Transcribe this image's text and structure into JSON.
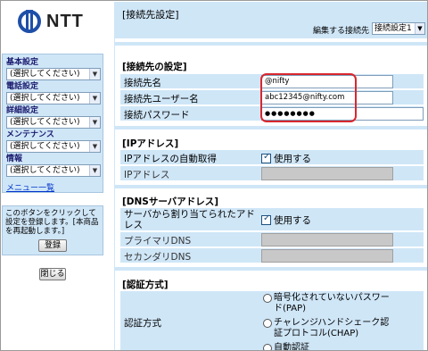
{
  "brand": {
    "logo_text": "NTT"
  },
  "sidebar": {
    "groups": [
      {
        "title": "基本設定",
        "value": "(選択してください)"
      },
      {
        "title": "電話設定",
        "value": "(選択してください)"
      },
      {
        "title": "詳細設定",
        "value": "(選択してください)"
      },
      {
        "title": "メンテナンス",
        "value": "(選択してください)"
      },
      {
        "title": "情報",
        "value": "(選択してください)"
      }
    ],
    "menu_list_link": "メニュー一覧",
    "apply_text": "このボタンをクリックして設定を登録します。[本商品を再起動します。]",
    "apply_button": "登録",
    "close_button": "閉じる"
  },
  "header": {
    "title": "[接続先設定]",
    "config_label": "編集する接続先",
    "config_value": "接続設定1"
  },
  "connection": {
    "section_title": "[接続先の設定]",
    "rows": [
      {
        "label": "接続先名",
        "value": "@nifty"
      },
      {
        "label": "接続先ユーザー名",
        "value": "abc12345@nifty.com"
      },
      {
        "label": "接続パスワード",
        "value": "●●●●●●●●"
      }
    ]
  },
  "ip": {
    "section_title": "[IPアドレス]",
    "auto_label": "IPアドレスの自動取得",
    "auto_checkbox_label": "使用する",
    "address_label": "IPアドレス"
  },
  "dns": {
    "section_title": "[DNSサーバアドレス]",
    "auto_label": "サーバから割り当てられたアドレス",
    "auto_checkbox_label": "使用する",
    "primary_label": "プライマリDNS",
    "secondary_label": "セカンダリDNS"
  },
  "auth": {
    "section_title": "[認証方式]",
    "label": "認証方式",
    "options": [
      "暗号化されていないパスワード(PAP)",
      "チャレンジハンドシェーク認証プロトコル(CHAP)",
      "自動認証"
    ]
  },
  "colors": {
    "panel": "#cfe6f7",
    "highlight": "#d9272e",
    "brand": "#1e4fa8"
  }
}
